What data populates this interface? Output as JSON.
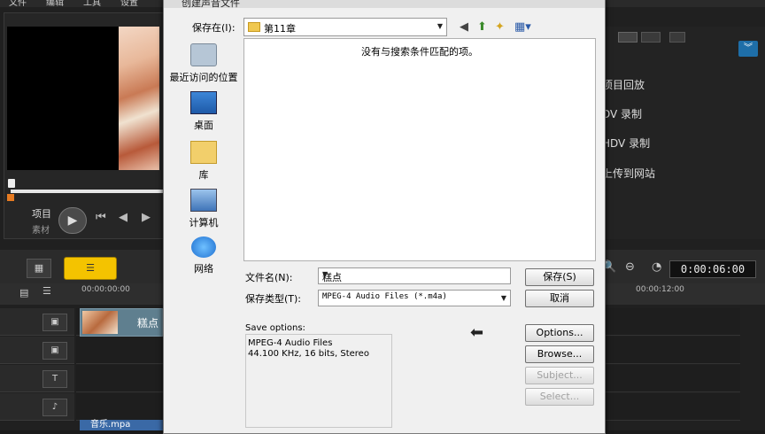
{
  "app": {
    "menu": [
      "文件",
      "编辑",
      "工具",
      "设置"
    ],
    "mode_labels": {
      "project": "项目",
      "clip": "素材"
    },
    "right_panel": {
      "items": [
        "项目回放",
        "DV 录制",
        "HDV 录制",
        "上传到网站"
      ]
    },
    "timeline": {
      "timecode": "0:00:06:00",
      "ruler": [
        "00:00:00:00",
        "00:00:12:00"
      ],
      "video_clip_label": "糕点",
      "audio_clip_label": "音乐.mpa"
    }
  },
  "dialog": {
    "title": "创建声音文件",
    "save_in_label": "保存在(I):",
    "save_in_value": "第11章",
    "places": [
      {
        "label": "最近访问的位置",
        "icon": "recent-places-icon"
      },
      {
        "label": "桌面",
        "icon": "desktop-icon"
      },
      {
        "label": "库",
        "icon": "libraries-icon"
      },
      {
        "label": "计算机",
        "icon": "computer-icon"
      },
      {
        "label": "网络",
        "icon": "network-icon"
      }
    ],
    "empty_message": "没有与搜索条件匹配的项。",
    "filename_label": "文件名(N):",
    "filename_value": "糕点",
    "filetype_label": "保存类型(T):",
    "filetype_value": "MPEG-4 Audio Files (*.m4a)",
    "buttons": {
      "save": "保存(S)",
      "cancel": "取消",
      "options": "Options...",
      "browse": "Browse...",
      "subject": "Subject...",
      "select": "Select..."
    },
    "save_options": {
      "label": "Save options:",
      "line1": "MPEG-4 Audio Files",
      "line2": "44.100 KHz, 16 bits, Stereo"
    }
  }
}
